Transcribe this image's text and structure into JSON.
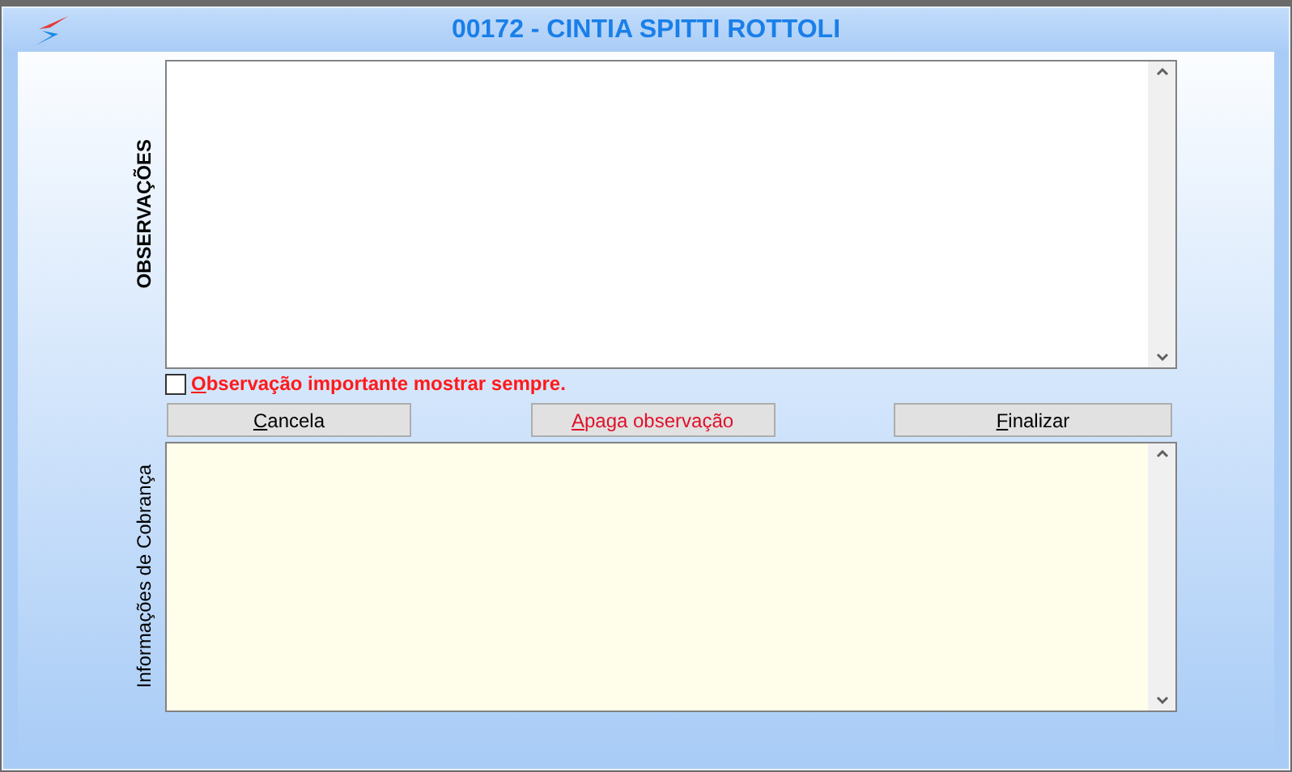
{
  "window": {
    "title": "00172 - CINTIA SPITTI ROTTOLI"
  },
  "observations": {
    "label": "OBSERVAÇÕES"
  },
  "important_checkbox": {
    "label_key": "O",
    "label_rest": "bservação importante mostrar sempre.",
    "checked": false
  },
  "buttons": [
    {
      "key": "C",
      "rest": "ancela",
      "kind": "normal"
    },
    {
      "key": "A",
      "rest": "paga observação",
      "kind": "danger"
    },
    {
      "key": "F",
      "rest": "inalizar",
      "kind": "normal"
    }
  ],
  "billing": {
    "label": "Informações de Cobrança"
  }
}
